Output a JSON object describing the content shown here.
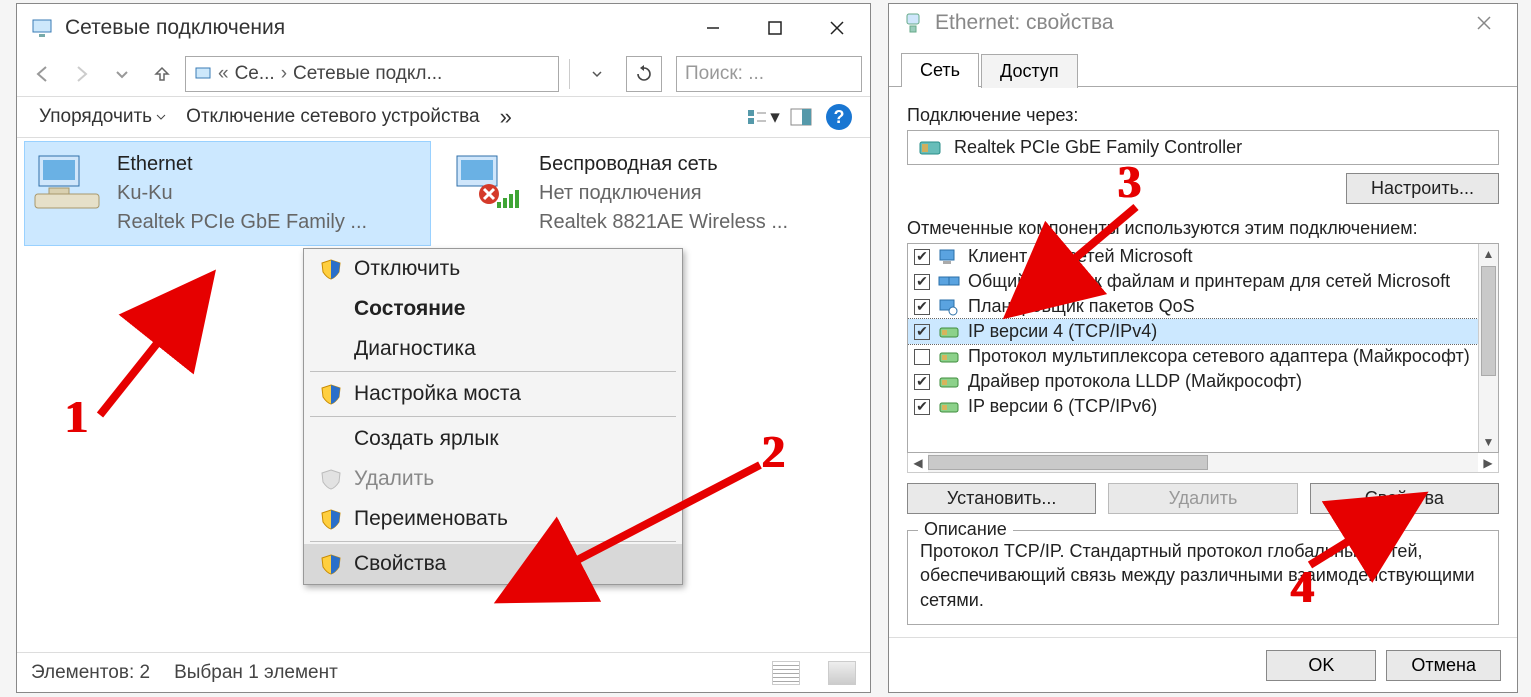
{
  "win1": {
    "title": "Сетевые подключения",
    "breadcrumb_root_short": "Се...",
    "breadcrumb_current": "Сетевые подкл...",
    "search_placeholder": "Поиск: ...",
    "cmd_sort": "Упорядочить",
    "cmd_disable": "Отключение сетевого устройства",
    "conn": {
      "ethernet": {
        "name": "Ethernet",
        "net": "Ku-Ku",
        "device": "Realtek PCIe GbE Family ..."
      },
      "wifi": {
        "name": "Беспроводная сеть",
        "net": "Нет подключения",
        "device": "Realtek 8821AE Wireless ..."
      }
    },
    "ctx": {
      "disable": "Отключить",
      "status": "Состояние",
      "diag": "Диагностика",
      "bridge": "Настройка моста",
      "shortcut": "Создать ярлык",
      "delete": "Удалить",
      "rename": "Переименовать",
      "properties": "Свойства"
    },
    "status_count": "Элементов: 2",
    "status_selected": "Выбран 1 элемент"
  },
  "win2": {
    "title": "Ethernet: свойства",
    "tab_net": "Сеть",
    "tab_share": "Доступ",
    "connect_via": "Подключение через:",
    "adapter": "Realtek PCIe GbE Family Controller",
    "configure": "Настроить...",
    "components_lbl": "Отмеченные компоненты используются этим подключением:",
    "components": [
      {
        "checked": true,
        "icon": "client",
        "label": "Клиент для сетей Microsoft"
      },
      {
        "checked": true,
        "icon": "share",
        "label": "Общий доступ к файлам и принтерам для сетей Microsoft"
      },
      {
        "checked": true,
        "icon": "sched",
        "label": "Планировщик пакетов QoS"
      },
      {
        "checked": true,
        "icon": "proto",
        "label": "IP версии 4 (TCP/IPv4)"
      },
      {
        "checked": false,
        "icon": "proto",
        "label": "Протокол мультиплексора сетевого адаптера (Майкрософт)"
      },
      {
        "checked": true,
        "icon": "proto",
        "label": "Драйвер протокола LLDP (Майкрософт)"
      },
      {
        "checked": true,
        "icon": "proto",
        "label": "IP версии 6 (TCP/IPv6)"
      }
    ],
    "btn_install": "Установить...",
    "btn_remove": "Удалить",
    "btn_props": "Свойства",
    "desc_title": "Описание",
    "desc_text": "Протокол TCP/IP. Стандартный протокол глобальных сетей, обеспечивающий связь между различными взаимодействующими сетями.",
    "ok": "OK",
    "cancel": "Отмена"
  },
  "annotations": {
    "l1": "1",
    "l2": "2",
    "l3": "3",
    "l4": "4"
  }
}
